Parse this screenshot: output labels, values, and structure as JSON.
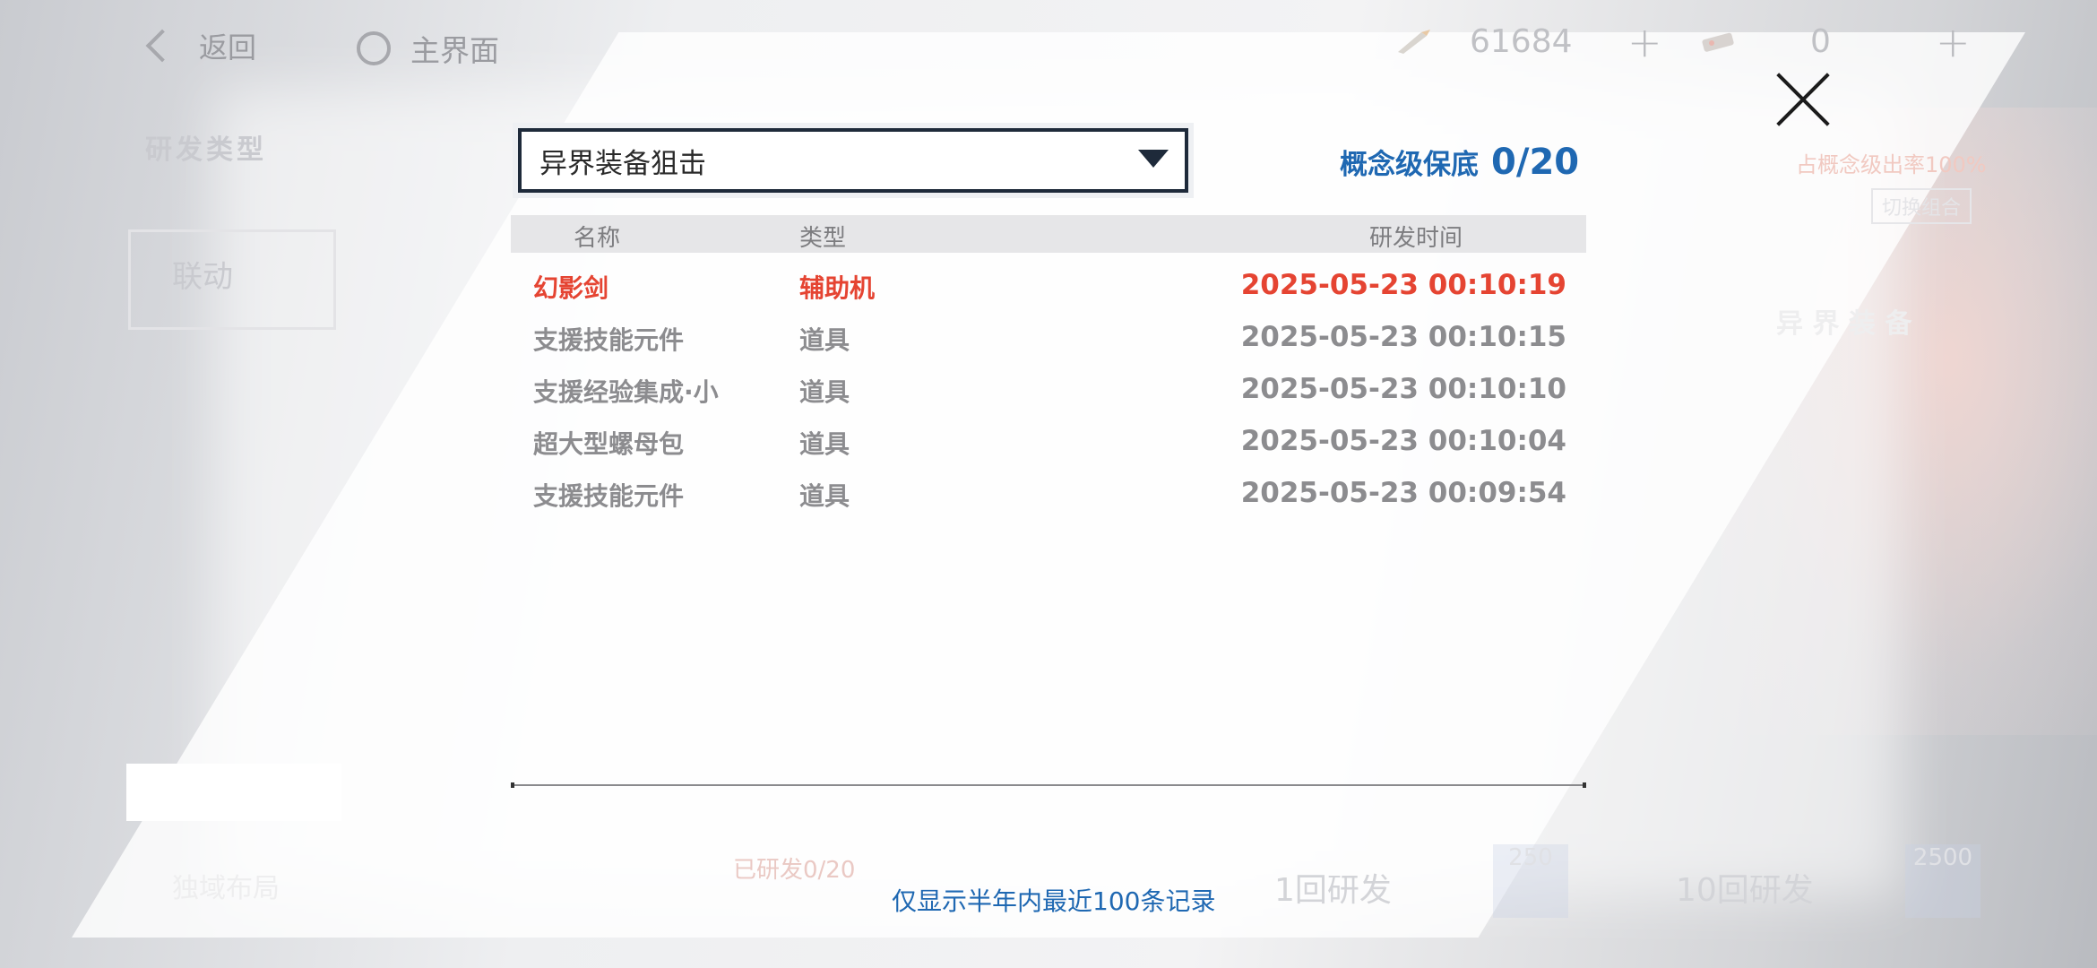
{
  "topbar": {
    "back_label": "返回",
    "home_label": "主界面",
    "currency1": "61684",
    "currency2": "0",
    "plus": "+"
  },
  "modal": {
    "dropdown_value": "异界装备狙击",
    "pity_label": "概念级保底",
    "pity_count": "0/20",
    "columns": {
      "name": "名称",
      "type": "类型",
      "time": "研发时间"
    },
    "rows": [
      {
        "name": "幻影剑",
        "type": "辅助机",
        "time": "2025-05-23 00:10:19",
        "highlight": true
      },
      {
        "name": "支援技能元件",
        "type": "道具",
        "time": "2025-05-23 00:10:15",
        "highlight": false
      },
      {
        "name": "支援经验集成·小",
        "type": "道具",
        "time": "2025-05-23 00:10:10",
        "highlight": false
      },
      {
        "name": "超大型螺母包",
        "type": "道具",
        "time": "2025-05-23 00:10:04",
        "highlight": false
      },
      {
        "name": "支援技能元件",
        "type": "道具",
        "time": "2025-05-23 00:09:54",
        "highlight": false
      }
    ],
    "footnote": "仅显示半年内最近100条记录"
  },
  "background": {
    "dev_type": "研发类型",
    "tab_linked": "联动",
    "right_label": "异 界 装 备",
    "switch_combo": "切换组合",
    "rate_text": "占概念级出率100%",
    "once": "1回研发",
    "ten": "10回研发",
    "cost1": "250",
    "cost10": "2500",
    "developed": "已研发0/20",
    "left_bottom": "独域布局"
  },
  "colors": {
    "accent_blue": "#1f68b2",
    "highlight_red": "#e54432"
  }
}
